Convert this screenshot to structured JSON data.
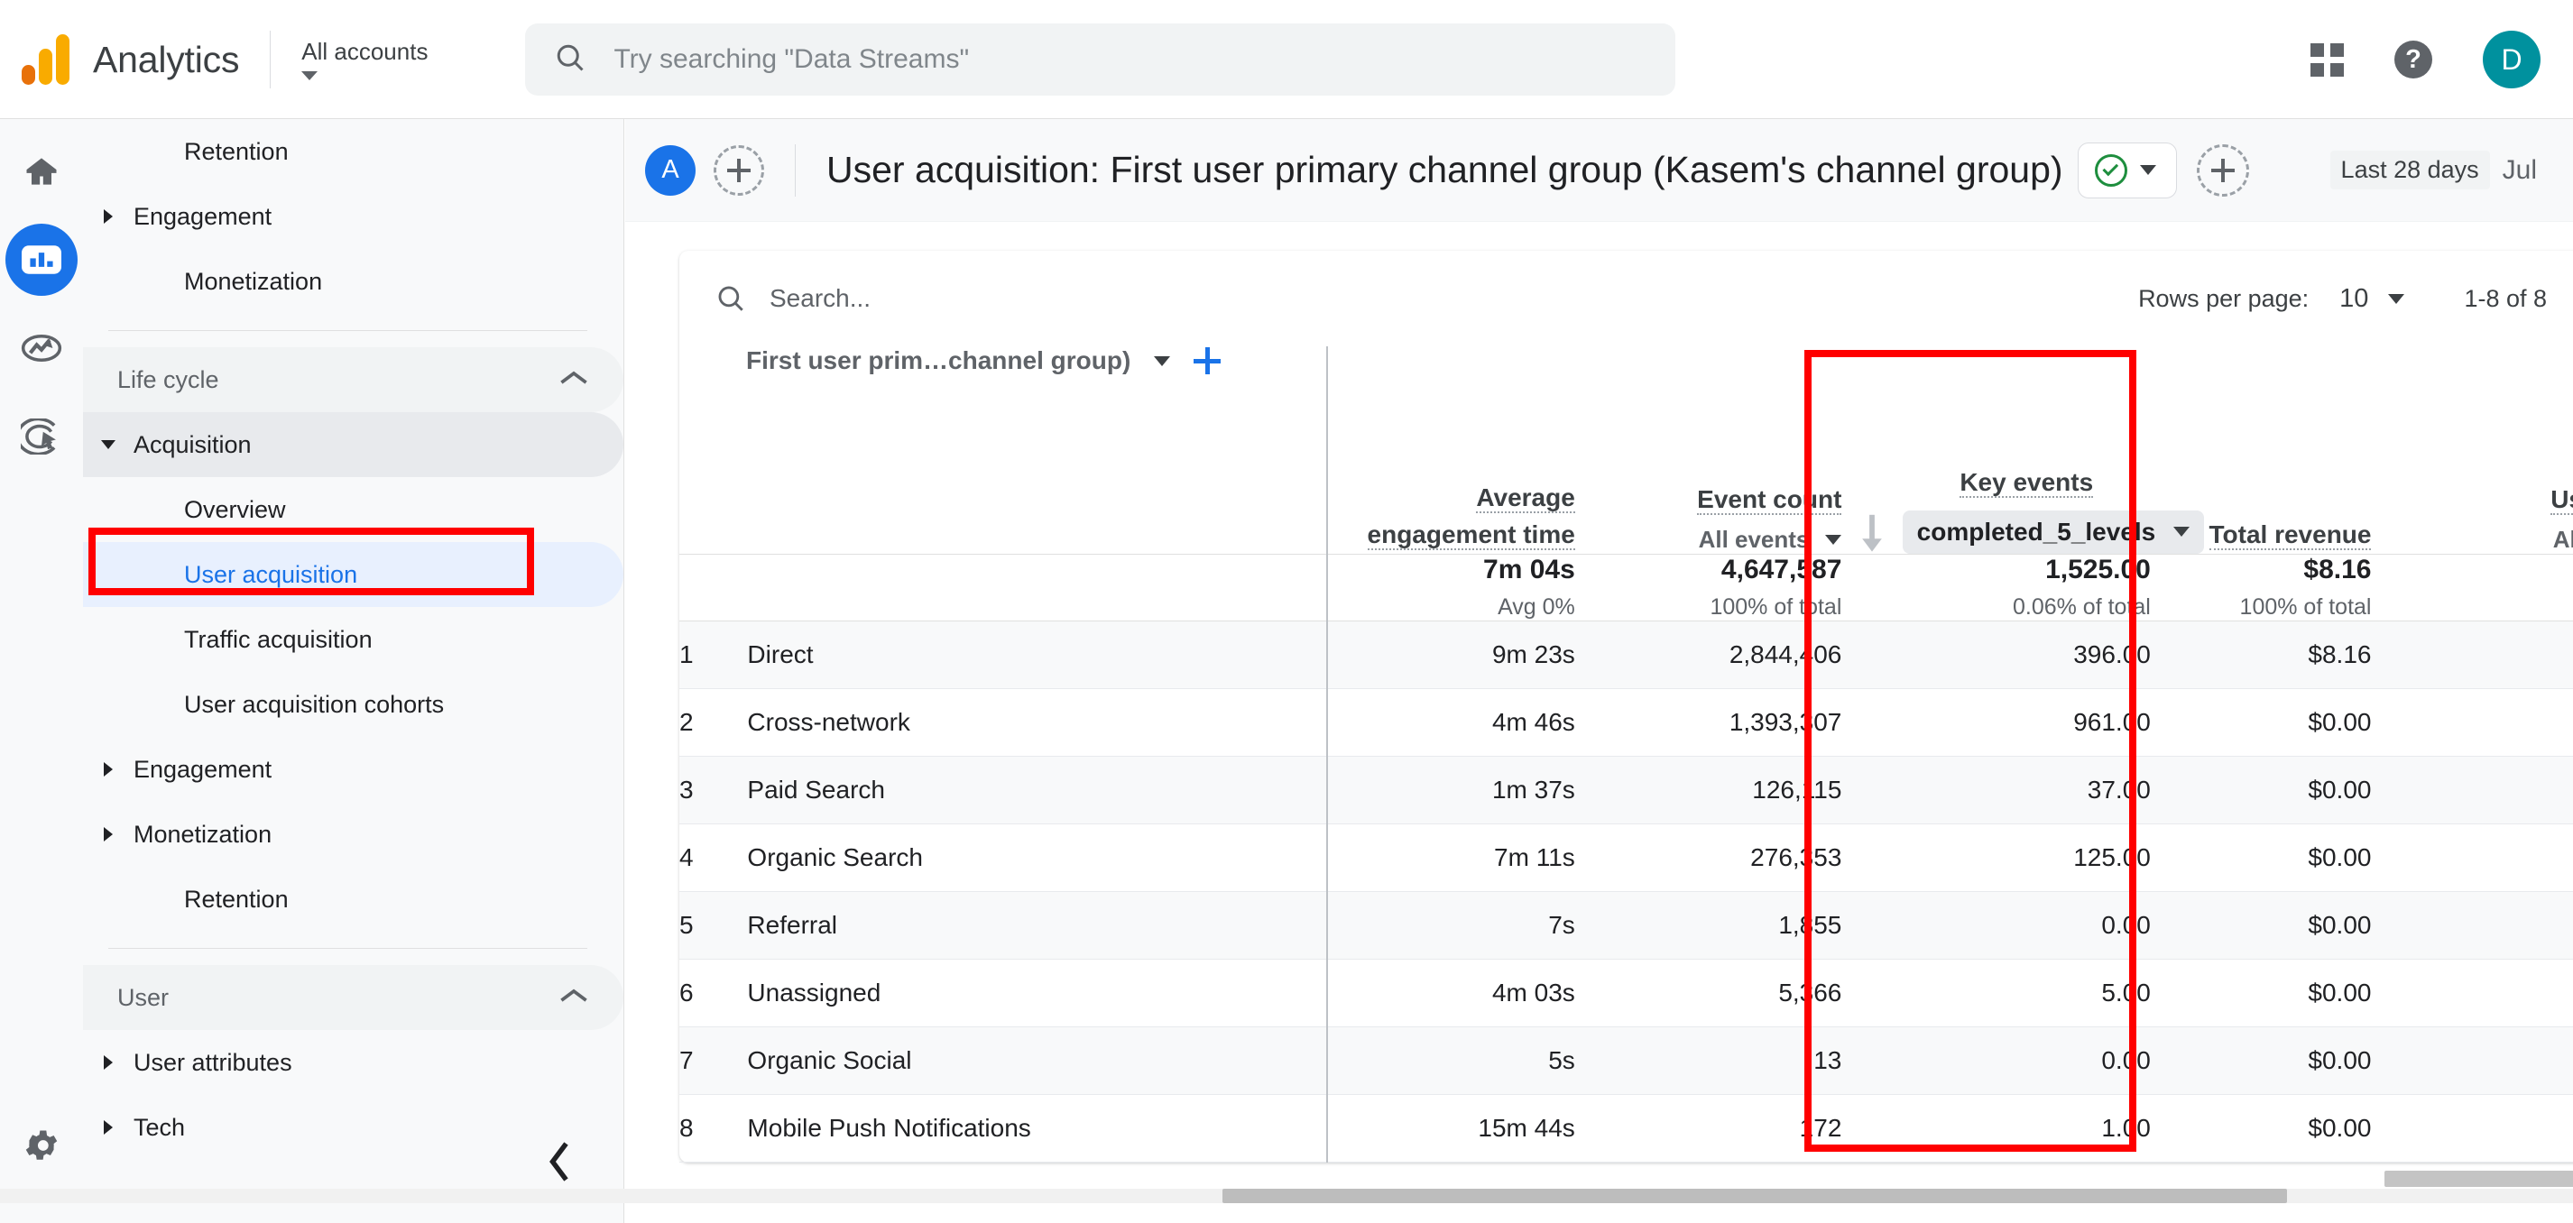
{
  "topbar": {
    "brand": "Analytics",
    "account_label": "All accounts",
    "search_placeholder": "Try searching \"Data Streams\"",
    "apps_icon": "grid-apps-icon",
    "help_icon": "help-icon",
    "help_glyph": "?",
    "avatar_initial": "D",
    "avatar_color": "#00919e"
  },
  "rail": {
    "items": [
      {
        "name": "home",
        "icon": "home-icon",
        "active": false
      },
      {
        "name": "reports",
        "icon": "reports-bar-chart-icon",
        "active": true
      },
      {
        "name": "explore",
        "icon": "explore-trend-icon",
        "active": false
      },
      {
        "name": "advertising",
        "icon": "advertising-target-icon",
        "active": false
      }
    ],
    "settings": {
      "name": "admin-settings",
      "icon": "gear-icon"
    }
  },
  "sidebar": {
    "items": [
      {
        "label": "Retention",
        "level": 2,
        "arrow": "none",
        "state": "normal"
      },
      {
        "label": "Engagement",
        "level": 1,
        "arrow": "right",
        "state": "normal"
      },
      {
        "label": "Monetization",
        "level": 2,
        "arrow": "none",
        "state": "normal"
      },
      {
        "label": "Life cycle",
        "level": 0,
        "arrow": "collapse-up",
        "state": "section"
      },
      {
        "label": "Acquisition",
        "level": 1,
        "arrow": "down",
        "state": "expanded"
      },
      {
        "label": "Overview",
        "level": 2,
        "arrow": "none",
        "state": "normal"
      },
      {
        "label": "User acquisition",
        "level": 2,
        "arrow": "none",
        "state": "selected"
      },
      {
        "label": "Traffic acquisition",
        "level": 2,
        "arrow": "none",
        "state": "normal"
      },
      {
        "label": "User acquisition cohorts",
        "level": 2,
        "arrow": "none",
        "state": "normal"
      },
      {
        "label": "Engagement",
        "level": 1,
        "arrow": "right",
        "state": "normal"
      },
      {
        "label": "Monetization",
        "level": 1,
        "arrow": "right",
        "state": "normal"
      },
      {
        "label": "Retention",
        "level": 2,
        "arrow": "none",
        "state": "normal"
      },
      {
        "label": "User",
        "level": 0,
        "arrow": "collapse-up",
        "state": "section"
      },
      {
        "label": "User attributes",
        "level": 1,
        "arrow": "right",
        "state": "normal"
      },
      {
        "label": "Tech",
        "level": 1,
        "arrow": "right",
        "state": "normal"
      }
    ],
    "collapse_icon": "chevron-left-icon"
  },
  "page_header": {
    "avatar_initial": "A",
    "add_comparison_icon": "add-comparison-icon",
    "title": "User acquisition: First user primary channel group (Kasem's channel group)",
    "verified_icon": "verified-check-icon",
    "verified_caret_icon": "chevron-down-icon",
    "add_icon": "add-icon",
    "date_range": "Last 28 days",
    "date_range_rest": "Jul"
  },
  "table_toolbar": {
    "search_icon": "search-icon",
    "search_placeholder": "Search...",
    "rows_per_page_label": "Rows per page:",
    "rows_per_page_value": "10",
    "rows_per_page_caret": "chevron-down-icon",
    "range_text": "1-8 of 8"
  },
  "chart_data": {
    "type": "table",
    "title": "User acquisition: First user primary channel group (Kasem's channel group)",
    "dimension_picker": "First user prim…channel group)",
    "columns": [
      {
        "key": "index",
        "title": "",
        "sub": ""
      },
      {
        "key": "dim",
        "title": "First user prim…channel group)",
        "sub": ""
      },
      {
        "key": "avg_eng",
        "title": "Average engagement time",
        "sub": ""
      },
      {
        "key": "events",
        "title": "Event count",
        "sub": "All events"
      },
      {
        "key": "key_events",
        "title": "Key events",
        "sub": "completed_5_levels"
      },
      {
        "key": "revenue",
        "title": "Total revenue",
        "sub": ""
      },
      {
        "key": "users",
        "title": "Us",
        "sub": "All"
      }
    ],
    "sorted_column": "key_events",
    "sort_direction": "descending",
    "totals": {
      "avg_eng": "7m 04s",
      "avg_eng_sub": "Avg 0%",
      "events": "4,647,587",
      "events_sub": "100% of total",
      "key_events": "1,525.00",
      "key_events_sub": "0.06% of total",
      "revenue": "$8.16",
      "revenue_sub": "100% of total"
    },
    "rows": [
      {
        "n": "1",
        "dim": "Direct",
        "avg_eng": "9m 23s",
        "events": "2,844,406",
        "key_events": "396.00",
        "revenue": "$8.16"
      },
      {
        "n": "2",
        "dim": "Cross-network",
        "avg_eng": "4m 46s",
        "events": "1,393,307",
        "key_events": "961.00",
        "revenue": "$0.00"
      },
      {
        "n": "3",
        "dim": "Paid Search",
        "avg_eng": "1m 37s",
        "events": "126,115",
        "key_events": "37.00",
        "revenue": "$0.00"
      },
      {
        "n": "4",
        "dim": "Organic Search",
        "avg_eng": "7m 11s",
        "events": "276,353",
        "key_events": "125.00",
        "revenue": "$0.00"
      },
      {
        "n": "5",
        "dim": "Referral",
        "avg_eng": "7s",
        "events": "1,855",
        "key_events": "0.00",
        "revenue": "$0.00"
      },
      {
        "n": "6",
        "dim": "Unassigned",
        "avg_eng": "4m 03s",
        "events": "5,366",
        "key_events": "5.00",
        "revenue": "$0.00"
      },
      {
        "n": "7",
        "dim": "Organic Social",
        "avg_eng": "5s",
        "events": "13",
        "key_events": "0.00",
        "revenue": "$0.00"
      },
      {
        "n": "8",
        "dim": "Mobile Push Notifications",
        "avg_eng": "15m 44s",
        "events": "172",
        "key_events": "1.00",
        "revenue": "$0.00"
      }
    ]
  },
  "annotations": {
    "color": "#ff0000",
    "boxes": [
      {
        "name": "highlight-sidebar-user-acquisition"
      },
      {
        "name": "highlight-key-events-column"
      }
    ]
  }
}
